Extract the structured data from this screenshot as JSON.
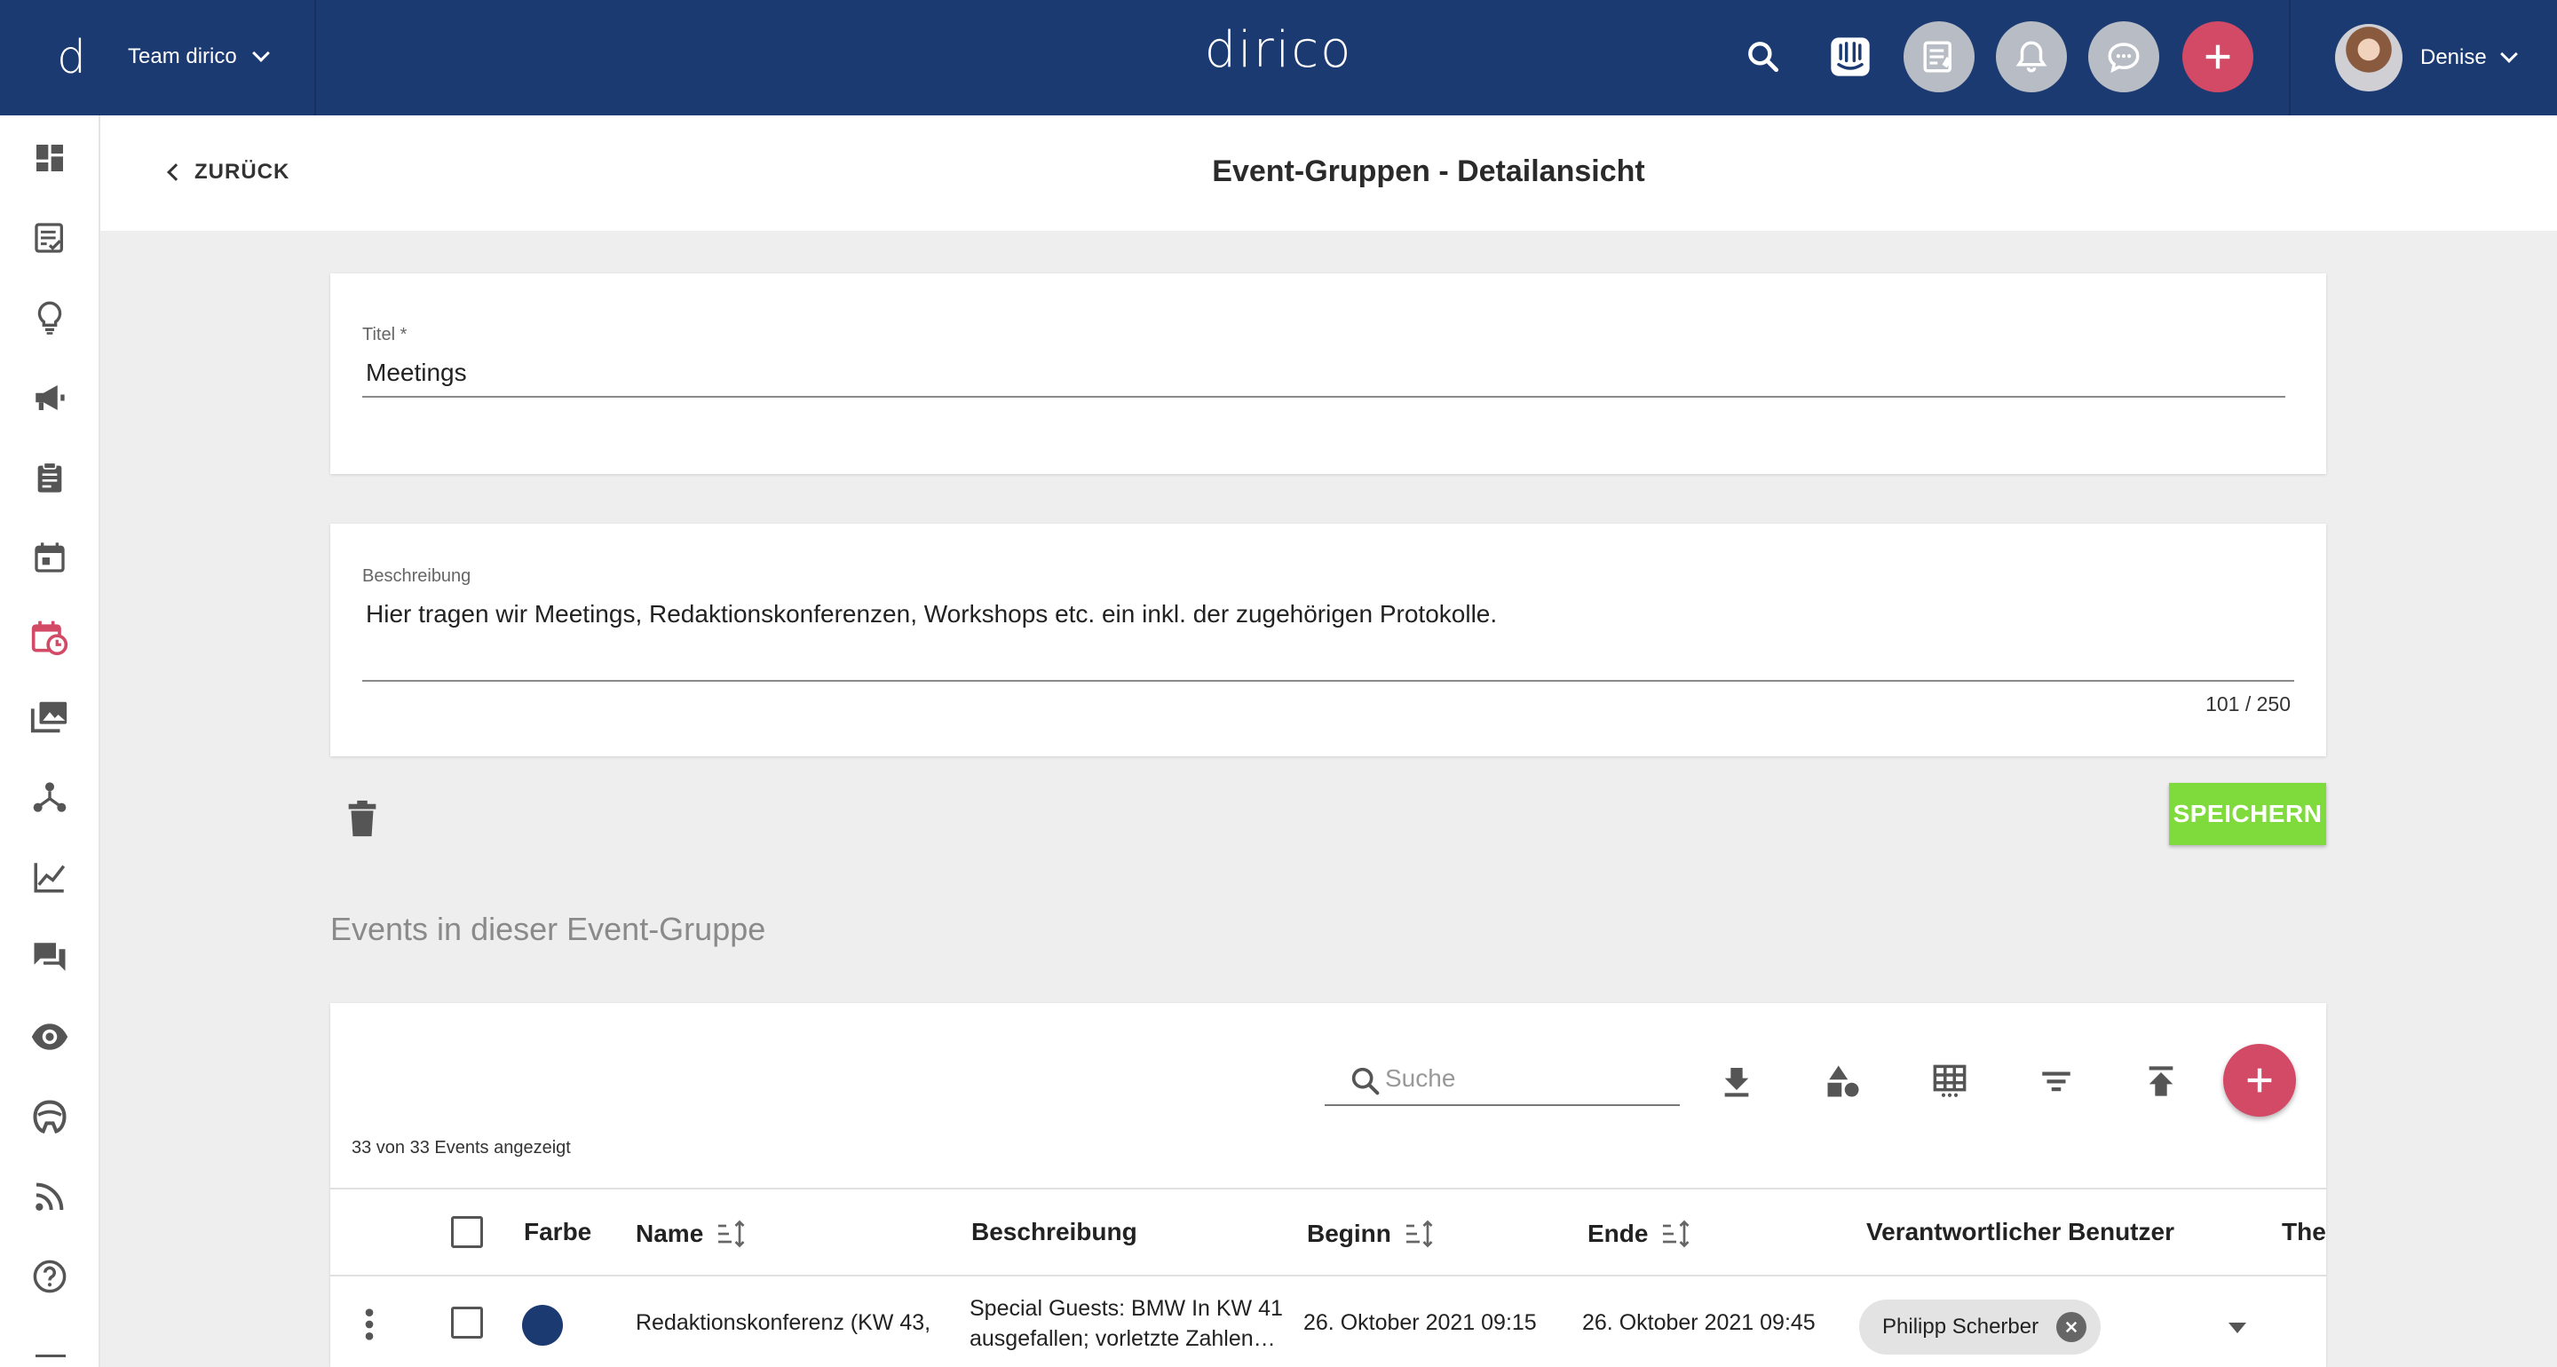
{
  "app": {
    "brand": "dirico",
    "logo_letter": "d",
    "team": "Team dirico",
    "user": "Denise"
  },
  "header": {
    "back_label": "ZURÜCK",
    "title": "Event-Gruppen - Detailansicht"
  },
  "form": {
    "title_label": "Titel *",
    "title_value": "Meetings",
    "description_label": "Beschreibung",
    "description_value": "Hier tragen wir Meetings, Redaktionskonferenzen, Workshops etc. ein inkl. der zugehörigen Protokolle.",
    "description_counter": "101 / 250",
    "save_label": "SPEICHERN"
  },
  "events": {
    "section_title": "Events in dieser Event-Gruppe",
    "search_placeholder": "Suche",
    "count_text": "33 von 33 Events angezeigt",
    "columns": {
      "color": "Farbe",
      "name": "Name",
      "description": "Beschreibung",
      "start": "Beginn",
      "end": "Ende",
      "responsible": "Verantwortlicher Benutzer",
      "topic": "The"
    },
    "rows": [
      {
        "color": "#1b3a72",
        "name": "Redaktionskonferenz (KW 43, …",
        "description_line1": "Special Guests: BMW In KW 41",
        "description_line2": "ausgefallen; vorletzte Zahlen…",
        "start": "26. Oktober 2021 09:15",
        "end": "26. Oktober 2021 09:45",
        "responsible": "Philipp Scherber"
      }
    ]
  },
  "colors": {
    "topbar": "#1b3a72",
    "accent_red": "#d24a65",
    "save_green": "#7fda3b"
  },
  "icons": {
    "topbar": [
      "search-icon",
      "intercom-icon",
      "notes-icon",
      "bell-icon",
      "chat-icon",
      "add-icon"
    ],
    "sidebar": [
      "dashboard-icon",
      "tasks-icon",
      "ideas-icon",
      "campaign-icon",
      "clipboard-icon",
      "calendar-icon",
      "event-calendar-icon",
      "media-icon",
      "network-icon",
      "analytics-icon",
      "forum-icon",
      "monitoring-icon",
      "helmet-icon",
      "rss-icon",
      "help-icon"
    ],
    "toolbar": [
      "download-icon",
      "shapes-icon",
      "table-columns-icon",
      "filter-icon",
      "upload-icon"
    ]
  }
}
